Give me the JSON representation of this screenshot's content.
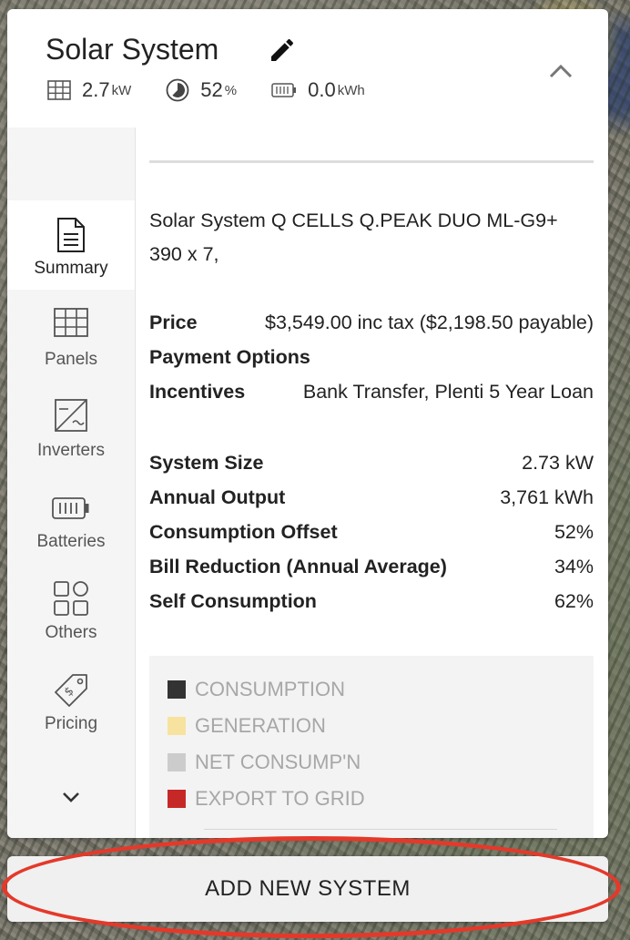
{
  "header": {
    "title": "Solar System",
    "stats": [
      {
        "icon": "solar-panel-icon",
        "value": "2.7",
        "unit": "kW"
      },
      {
        "icon": "offset-pie-icon",
        "value": "52",
        "unit": "%"
      },
      {
        "icon": "battery-icon",
        "value": "0.0",
        "unit": "kWh"
      }
    ]
  },
  "sidebar": {
    "items": [
      {
        "label": "Summary",
        "icon": "document-icon",
        "active": true
      },
      {
        "label": "Panels",
        "icon": "panel-grid-icon",
        "active": false
      },
      {
        "label": "Inverters",
        "icon": "inverter-icon",
        "active": false
      },
      {
        "label": "Batteries",
        "icon": "battery-icon",
        "active": false
      },
      {
        "label": "Others",
        "icon": "apps-grid-icon",
        "active": false
      },
      {
        "label": "Pricing",
        "icon": "price-tag-icon",
        "active": false
      }
    ]
  },
  "summary": {
    "system_name": "Solar System Q CELLS Q.PEAK DUO ML-G9+ 390 x 7,",
    "price_label": "Price",
    "price_value": "$3,549.00 inc tax ($2,198.50 payable)",
    "payment_label": "Payment Options",
    "incentives_label": "Incentives",
    "incentives_value": "Bank Transfer, Plenti 5 Year Loan",
    "metrics": [
      {
        "label": "System Size",
        "value": "2.73 kW"
      },
      {
        "label": "Annual Output",
        "value": "3,761 kWh"
      },
      {
        "label": "Consumption Offset",
        "value": "52%"
      },
      {
        "label": "Bill Reduction (Annual Average)",
        "value": "34%"
      },
      {
        "label": "Self Consumption",
        "value": "62%"
      }
    ]
  },
  "legend": [
    {
      "label": "CONSUMPTION",
      "color": "#333333"
    },
    {
      "label": "GENERATION",
      "color": "#f7e39f"
    },
    {
      "label": "NET CONSUMP'N",
      "color": "#cccccc"
    },
    {
      "label": "EXPORT TO GRID",
      "color": "#c62828"
    }
  ],
  "actions": {
    "add_system_label": "ADD NEW SYSTEM"
  },
  "colors": {
    "highlight_ring": "#e4392a"
  }
}
